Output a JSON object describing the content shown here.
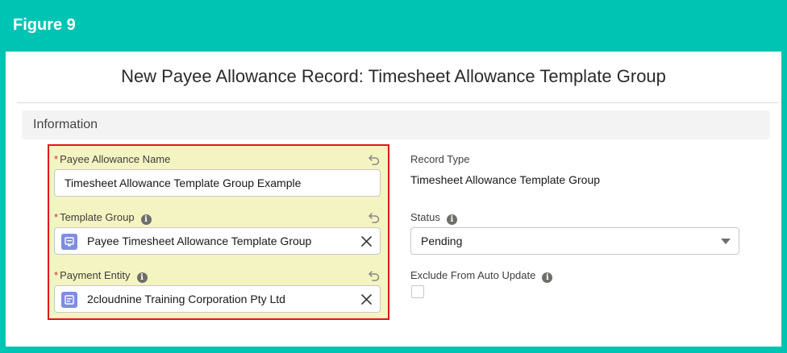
{
  "figure": {
    "label": "Figure 9"
  },
  "modal": {
    "title": "New Payee Allowance Record: Timesheet Allowance Template Group"
  },
  "section": {
    "title": "Information"
  },
  "form": {
    "payee_allowance_name": {
      "label": "Payee Allowance Name",
      "required_marker": "*",
      "value": "Timesheet Allowance Template Group Example"
    },
    "template_group": {
      "label": "Template Group",
      "required_marker": "*",
      "info": "i",
      "value": "Payee Timesheet Allowance Template Group",
      "icon": "record-icon"
    },
    "payment_entity": {
      "label": "Payment Entity",
      "required_marker": "*",
      "info": "i",
      "value": "2cloudnine Training Corporation Pty Ltd",
      "icon": "record-icon"
    },
    "record_type": {
      "label": "Record Type",
      "value": "Timesheet Allowance Template Group"
    },
    "status": {
      "label": "Status",
      "info": "i",
      "selected": "Pending"
    },
    "exclude_from_auto_update": {
      "label": "Exclude From Auto Update",
      "info": "i",
      "checked": false
    }
  },
  "colors": {
    "frame": "#00c4b3",
    "highlight_border": "#e3141a",
    "highlight_fill": "#f4f4c2",
    "lookup_icon": "#7f8de1"
  }
}
